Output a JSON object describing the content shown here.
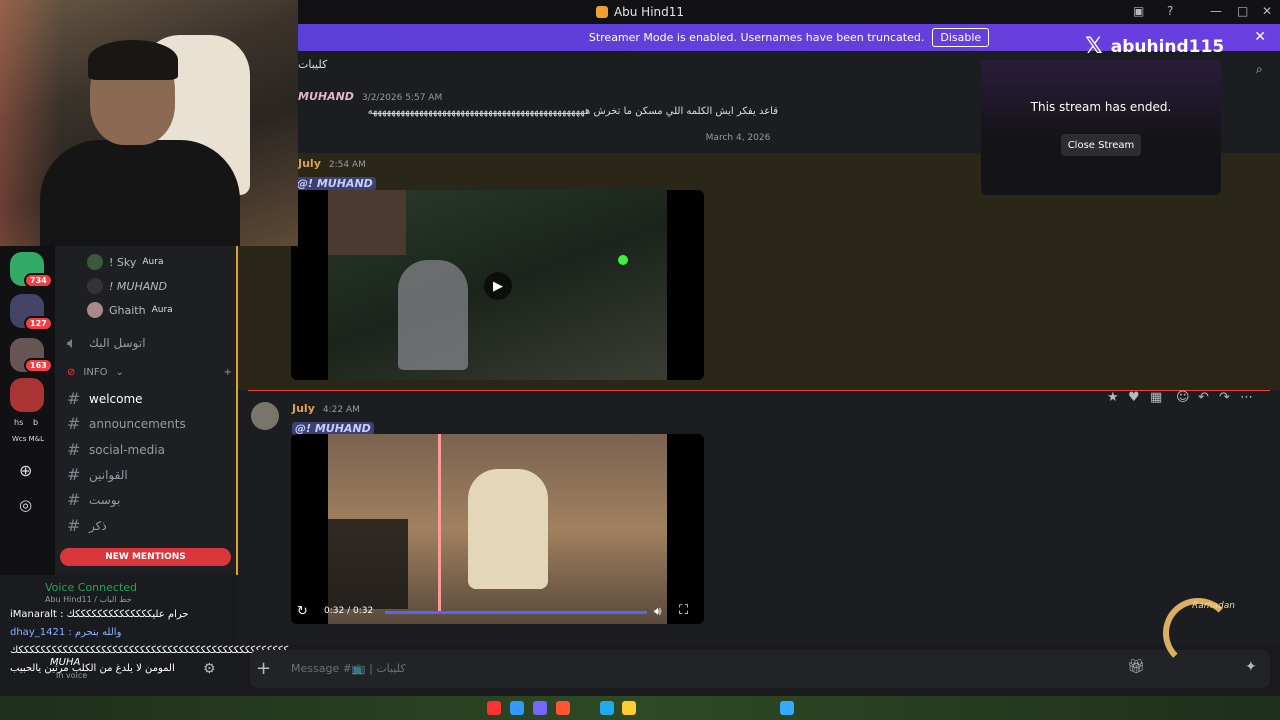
{
  "window": {
    "title": "Abu Hind11"
  },
  "banner": {
    "text": "Streamer Mode is enabled. Usernames have been truncated.",
    "disable_label": "Disable",
    "close": "✕"
  },
  "overlay": {
    "x_handle": "abuhind115"
  },
  "channel_header": {
    "name": "كليبات"
  },
  "messages": [
    {
      "author": "MUHAND",
      "timestamp": "3/2/2026 5:57 AM",
      "text": "قاعد يفكر ايش الكلمه اللي مسكن ما تخرش هههههههههههههههههههههههههههههههههههههههههههههههه"
    },
    {
      "author": "July",
      "timestamp": "2:54 AM",
      "mention": "@! MUHAND"
    },
    {
      "author": "July",
      "timestamp": "4:22 AM",
      "mention": "@! MUHAND",
      "video_time": "0:32 / 0:32",
      "video_progress": 1.0
    }
  ],
  "date_divider": "March 4, 2026",
  "stream_panel": {
    "message": "This stream has ended.",
    "close_label": "Close Stream"
  },
  "voice_users": [
    {
      "name": "! Sky",
      "tag": "Aura"
    },
    {
      "name": "! MUHAND",
      "tag": ""
    },
    {
      "name": "Ghaith",
      "tag": "Aura"
    }
  ],
  "voice_channel": "اتوسل اليك",
  "category": "INFO",
  "channels": [
    {
      "name": "welcome",
      "active": true
    },
    {
      "name": "announcements",
      "active": false
    },
    {
      "name": "social-media",
      "active": false
    },
    {
      "name": "القوانين",
      "active": false
    },
    {
      "name": "بوست",
      "active": false
    },
    {
      "name": "ذكر",
      "active": false
    }
  ],
  "new_mentions": "NEW MENTIONS",
  "server_badges": [
    "734",
    "127",
    "163"
  ],
  "server_labels": {
    "hs": "hs",
    "b": "b",
    "wcs": "Wcs M&L"
  },
  "voice_panel": {
    "status": "Voice Connected",
    "sub": "Abu Hind11 / خط الباب",
    "chat_lines": [
      "iManaralt : حرام عليككككككككككككككك",
      "dhay_1421 : والله بنحرم",
      "كككككككككككككككككككككككككككككككككككككككككككككككككك",
      "MUHA",
      "المومن لا يلدغ من الكلب مرتين يالحبيب",
      "In voice"
    ]
  },
  "composer": {
    "placeholder": "Message #📺 | كليبات"
  },
  "ramadan": "Ramadan",
  "colors": {
    "accent": "#5865f2",
    "mention_bg": "#3c4270",
    "danger": "#da373c",
    "online": "#23a55a"
  }
}
